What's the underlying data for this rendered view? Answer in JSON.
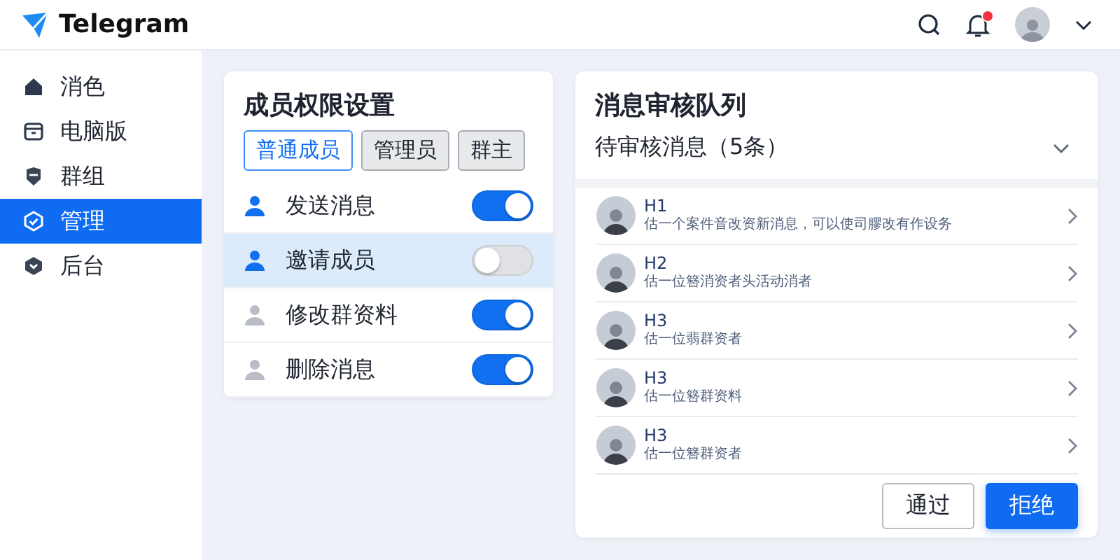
{
  "header": {
    "brand": "Telegram",
    "notification_badge": true
  },
  "sidebar": {
    "items": [
      {
        "label": "消色",
        "kind": "home",
        "selected": false
      },
      {
        "label": "电脑版",
        "kind": "box",
        "selected": false
      },
      {
        "label": "群组",
        "kind": "shield",
        "selected": false
      },
      {
        "label": "管理",
        "kind": "check",
        "selected": true
      },
      {
        "label": "后台",
        "kind": "hex",
        "selected": false
      }
    ]
  },
  "permissions": {
    "title": "成员权限设置",
    "tabs": [
      {
        "label": "普通成员",
        "selected": true
      },
      {
        "label": "管理员",
        "selected": false
      },
      {
        "label": "群主",
        "selected": false
      }
    ],
    "items": [
      {
        "label": "发送消息",
        "active": true,
        "on": true,
        "selected": false
      },
      {
        "label": "邀请成员",
        "active": true,
        "on": false,
        "selected": true
      },
      {
        "label": "修改群资料",
        "active": false,
        "on": true,
        "selected": false
      },
      {
        "label": "删除消息",
        "active": false,
        "on": true,
        "selected": false
      }
    ]
  },
  "queue": {
    "title": "消息审核队列",
    "section": "待审核消息（5条）",
    "expanded": true,
    "messages": [
      {
        "name": "H1",
        "text": "估一个案件音改资新消息，可以使司膠改有作设务"
      },
      {
        "name": "H2",
        "text": "估一位簪消资者头活动消者"
      },
      {
        "name": "H3",
        "text": "估一位翡群资者"
      },
      {
        "name": "H3",
        "text": "估一位簪群资料"
      },
      {
        "name": "H3",
        "text": "估一位簪群资者"
      }
    ],
    "buttons": [
      {
        "label": "通过",
        "kind": "secondary"
      },
      {
        "label": "拒绝",
        "kind": "primary"
      }
    ]
  }
}
